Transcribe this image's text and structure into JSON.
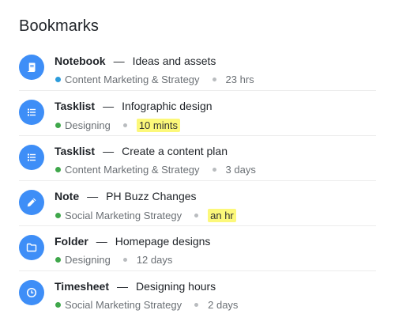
{
  "page": {
    "title": "Bookmarks"
  },
  "colors": {
    "icon_bg": "#3e8ef7",
    "category_blue": "#2d9cdb",
    "category_green": "#3fa74b",
    "highlight": "#fcf87a"
  },
  "bookmarks": [
    {
      "icon": "notebook-icon",
      "type": "Notebook",
      "title": "Ideas and assets",
      "category": "Content Marketing & Strategy",
      "category_color": "#2d9cdb",
      "time": "23 hrs",
      "highlight": false
    },
    {
      "icon": "list-icon",
      "type": "Tasklist",
      "title": "Infographic design",
      "category": "Designing",
      "category_color": "#3fa74b",
      "time": "10 mints",
      "highlight": true
    },
    {
      "icon": "list-icon",
      "type": "Tasklist",
      "title": "Create a content plan",
      "category": "Content Marketing & Strategy",
      "category_color": "#3fa74b",
      "time": "3 days",
      "highlight": false
    },
    {
      "icon": "pencil-icon",
      "type": "Note",
      "title": "PH Buzz Changes",
      "category": "Social Marketing Strategy",
      "category_color": "#3fa74b",
      "time": "an hr",
      "highlight": true
    },
    {
      "icon": "folder-icon",
      "type": "Folder",
      "title": "Homepage designs",
      "category": "Designing",
      "category_color": "#3fa74b",
      "time": "12 days",
      "highlight": false
    },
    {
      "icon": "clock-icon",
      "type": "Timesheet",
      "title": "Designing hours",
      "category": "Social Marketing Strategy",
      "category_color": "#3fa74b",
      "time": "2 days",
      "highlight": false
    }
  ]
}
